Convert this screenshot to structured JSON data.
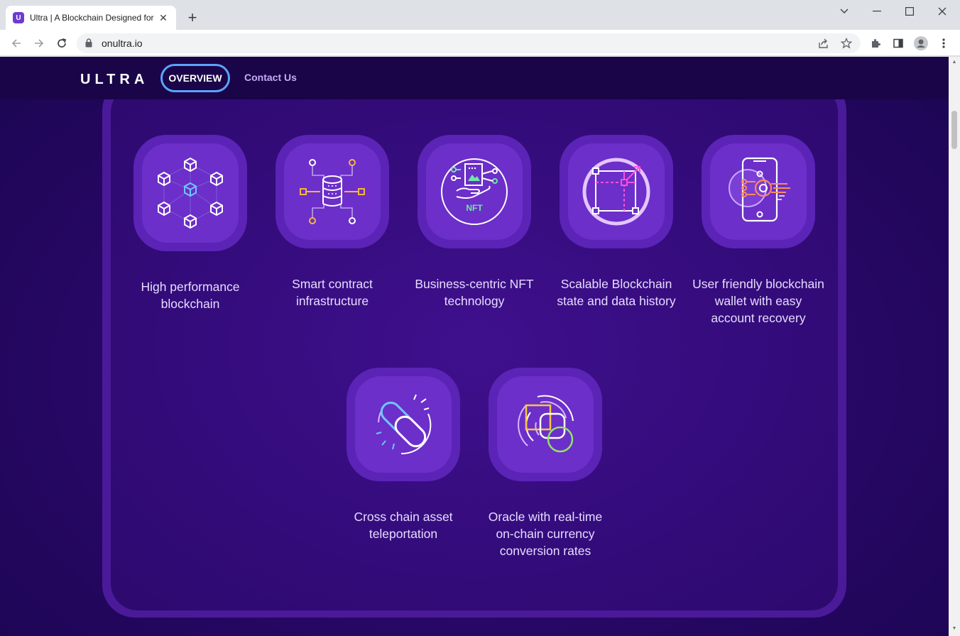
{
  "browser": {
    "tab_title": "Ultra | A Blockchain Designed for",
    "tab_favicon_letter": "U",
    "url": "onultra.io"
  },
  "site": {
    "logo": "ULTRA",
    "nav_overview": "OVERVIEW",
    "nav_contact": "Contact Us"
  },
  "features": [
    {
      "label": "High performance blockchain",
      "icon": "blockchain-network-icon"
    },
    {
      "label": "Smart contract infrastructure",
      "icon": "database-circuit-icon"
    },
    {
      "label": "Business-centric NFT technology",
      "icon": "nft-hand-icon",
      "icon_text": "NFT"
    },
    {
      "label": "Scalable Blockchain state and data history",
      "icon": "scale-square-icon"
    },
    {
      "label": "User friendly blockchain wallet with easy account recovery",
      "icon": "phone-wallet-icon"
    },
    {
      "label": "Cross chain asset teleportation",
      "icon": "chain-link-icon"
    },
    {
      "label": "Oracle with real-time on-chain currency conversion rates",
      "icon": "oracle-shapes-icon"
    }
  ],
  "colors": {
    "page_bg": "#2a086a",
    "nav_bg": "#1a0548",
    "tile_outer": "#5b23b6",
    "tile_inner": "#6c2fc9",
    "overview_border": "#5aa3ff",
    "contact_link": "#c8aaf5"
  }
}
